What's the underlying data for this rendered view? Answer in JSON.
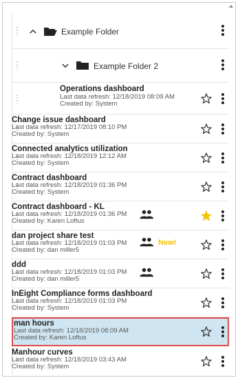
{
  "folders": [
    {
      "label": "Example Folder",
      "expanded": true
    },
    {
      "label": "Example Folder 2",
      "expanded": true
    }
  ],
  "items": [
    {
      "title": "Operations dashboard",
      "refresh": "Last data refresh: 12/18/2019 08:09 AM",
      "created": "Created by: System",
      "starred": false,
      "shared": false,
      "new": "",
      "selected": false
    },
    {
      "title": "Change issue dashboard",
      "refresh": "Last data refresh: 12/17/2019 08:10 PM",
      "created": "Created by: System",
      "starred": false,
      "shared": false,
      "new": "",
      "selected": false
    },
    {
      "title": "Connected analytics utilization",
      "refresh": "Last data refresh: 12/18/2019 12:12 AM",
      "created": "Created by: System",
      "starred": false,
      "shared": false,
      "new": "",
      "selected": false
    },
    {
      "title": "Contract dashboard",
      "refresh": "Last data refresh: 12/18/2019 01:36 PM",
      "created": "Created by: System",
      "starred": false,
      "shared": false,
      "new": "",
      "selected": false
    },
    {
      "title": "Contract dashboard - KL",
      "refresh": "Last data refresh: 12/18/2019 01:36 PM",
      "created": "Created by: Karen Loftus",
      "starred": true,
      "shared": true,
      "new": "",
      "selected": false
    },
    {
      "title": "dan project share test",
      "refresh": "Last data refresh: 12/18/2019 01:03 PM",
      "created": "Created by: dan miller5",
      "starred": false,
      "shared": true,
      "new": "New!",
      "selected": false
    },
    {
      "title": "ddd",
      "refresh": "Last data refresh: 12/18/2019 01:03 PM",
      "created": "Created by: dan miller5",
      "starred": false,
      "shared": true,
      "new": "",
      "selected": false
    },
    {
      "title": "InEight Compliance forms dashboard",
      "refresh": "Last data refresh: 12/18/2019 01:03 PM",
      "created": "Created by: System",
      "starred": false,
      "shared": false,
      "new": "",
      "selected": false
    },
    {
      "title": "man hours",
      "refresh": "Last data refresh: 12/18/2019 08:09 AM",
      "created": "Created by: Karen Loftus",
      "starred": false,
      "shared": false,
      "new": "",
      "selected": true
    },
    {
      "title": "Manhour curves",
      "refresh": "Last data refresh: 12/18/2019 03:43 AM",
      "created": "Created by: System",
      "starred": false,
      "shared": false,
      "new": "",
      "selected": false
    }
  ],
  "colors": {
    "accent_star": "#f5c400",
    "selected_bg": "#cfe6f2",
    "selected_border": "#e04a4a"
  }
}
